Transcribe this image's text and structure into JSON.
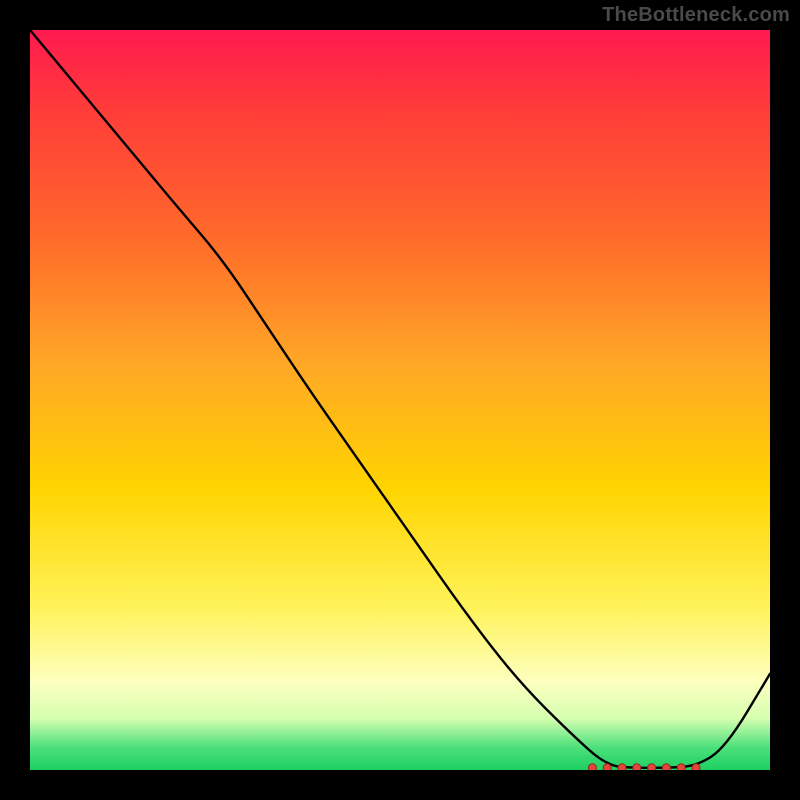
{
  "attribution": "TheBottleneck.com",
  "chart_data": {
    "type": "line",
    "title": "",
    "xlabel": "",
    "ylabel": "",
    "x": [
      0.0,
      0.05,
      0.1,
      0.15,
      0.2,
      0.26,
      0.32,
      0.38,
      0.45,
      0.52,
      0.59,
      0.66,
      0.73,
      0.78,
      0.82,
      0.86,
      0.9,
      0.94,
      1.0
    ],
    "y": [
      1.0,
      0.94,
      0.88,
      0.82,
      0.76,
      0.69,
      0.6,
      0.51,
      0.41,
      0.31,
      0.21,
      0.12,
      0.05,
      0.005,
      0.003,
      0.003,
      0.005,
      0.03,
      0.13
    ],
    "xlim": [
      0,
      1
    ],
    "ylim": [
      0,
      1
    ],
    "marker_cluster_x": [
      0.76,
      0.78,
      0.8,
      0.82,
      0.84,
      0.86,
      0.88,
      0.9
    ],
    "marker_cluster_y": 0.003,
    "gradient_maps_axis": "y",
    "gradient_meaning": "green = optimal / low bottleneck, red = high bottleneck"
  },
  "colors": {
    "curve": "#000000",
    "marker_fill": "#e4463b",
    "marker_stroke": "#9c241b",
    "attribution_text": "#4a4a4a"
  }
}
